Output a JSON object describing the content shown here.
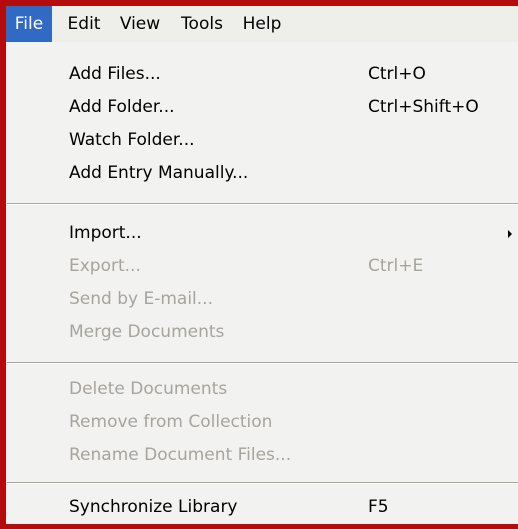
{
  "menubar": {
    "items": [
      {
        "label": "File",
        "active": true
      },
      {
        "label": "Edit",
        "active": false
      },
      {
        "label": "View",
        "active": false
      },
      {
        "label": "Tools",
        "active": false
      },
      {
        "label": "Help",
        "active": false
      }
    ]
  },
  "file_menu": {
    "groups": [
      [
        {
          "label": "Add Files...",
          "shortcut": "Ctrl+O",
          "enabled": true
        },
        {
          "label": "Add Folder...",
          "shortcut": "Ctrl+Shift+O",
          "enabled": true
        },
        {
          "label": "Watch Folder...",
          "shortcut": "",
          "enabled": true
        },
        {
          "label": "Add Entry Manually...",
          "shortcut": "",
          "enabled": true
        }
      ],
      [
        {
          "label": "Import...",
          "shortcut": "",
          "enabled": true,
          "submenu": true
        },
        {
          "label": "Export...",
          "shortcut": "Ctrl+E",
          "enabled": false
        },
        {
          "label": "Send by E-mail...",
          "shortcut": "",
          "enabled": false
        },
        {
          "label": "Merge Documents",
          "shortcut": "",
          "enabled": false
        }
      ],
      [
        {
          "label": "Delete Documents",
          "shortcut": "",
          "enabled": false
        },
        {
          "label": "Remove from Collection",
          "shortcut": "",
          "enabled": false
        },
        {
          "label": "Rename Document Files...",
          "shortcut": "",
          "enabled": false
        }
      ],
      [
        {
          "label": "Synchronize Library",
          "shortcut": "F5",
          "enabled": true
        }
      ]
    ]
  },
  "colors": {
    "frame_border": "#b40c0c",
    "menu_background": "#f2f2f0",
    "highlight": "#316ac5",
    "disabled_text": "#a6a49c"
  }
}
